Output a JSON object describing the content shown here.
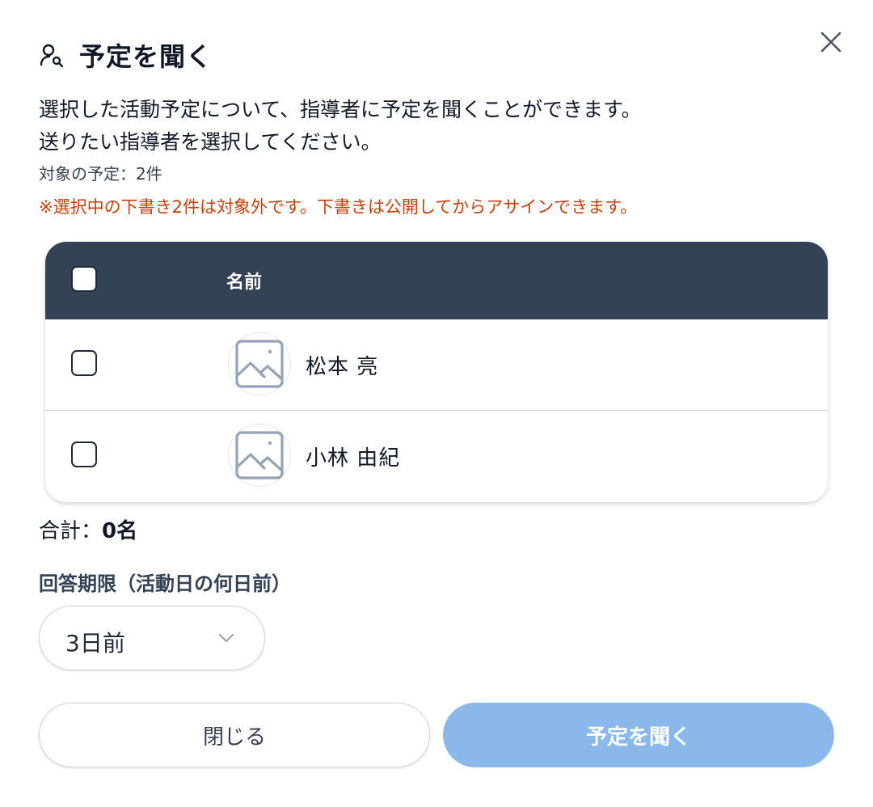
{
  "modal": {
    "title": "予定を聞く",
    "description_line1": "選択した活動予定について、指導者に予定を聞くことができます。",
    "description_line2": "送りたい指導者を選択してください。",
    "target_text": "対象の予定：2件",
    "warning_text": "※選択中の下書き2件は対象外です。下書きは公開してからアサインできます。"
  },
  "table": {
    "header_name": "名前",
    "rows": [
      {
        "name": "松本 亮",
        "checked": false
      },
      {
        "name": "小林 由紀",
        "checked": false
      }
    ]
  },
  "total": {
    "label": "合計：",
    "value": "0名"
  },
  "deadline": {
    "label": "回答期限（活動日の何日前）",
    "selected": "3日前"
  },
  "buttons": {
    "close_label": "閉じる",
    "ask_label": "予定を聞く"
  },
  "colors": {
    "header_bg": "#344256",
    "warning": "#c2410c",
    "primary_disabled": "#8bb8eb"
  },
  "icons": {
    "title": "user-search-icon",
    "close": "close-icon",
    "avatar": "image-placeholder-icon",
    "dropdown": "chevron-down-icon"
  }
}
